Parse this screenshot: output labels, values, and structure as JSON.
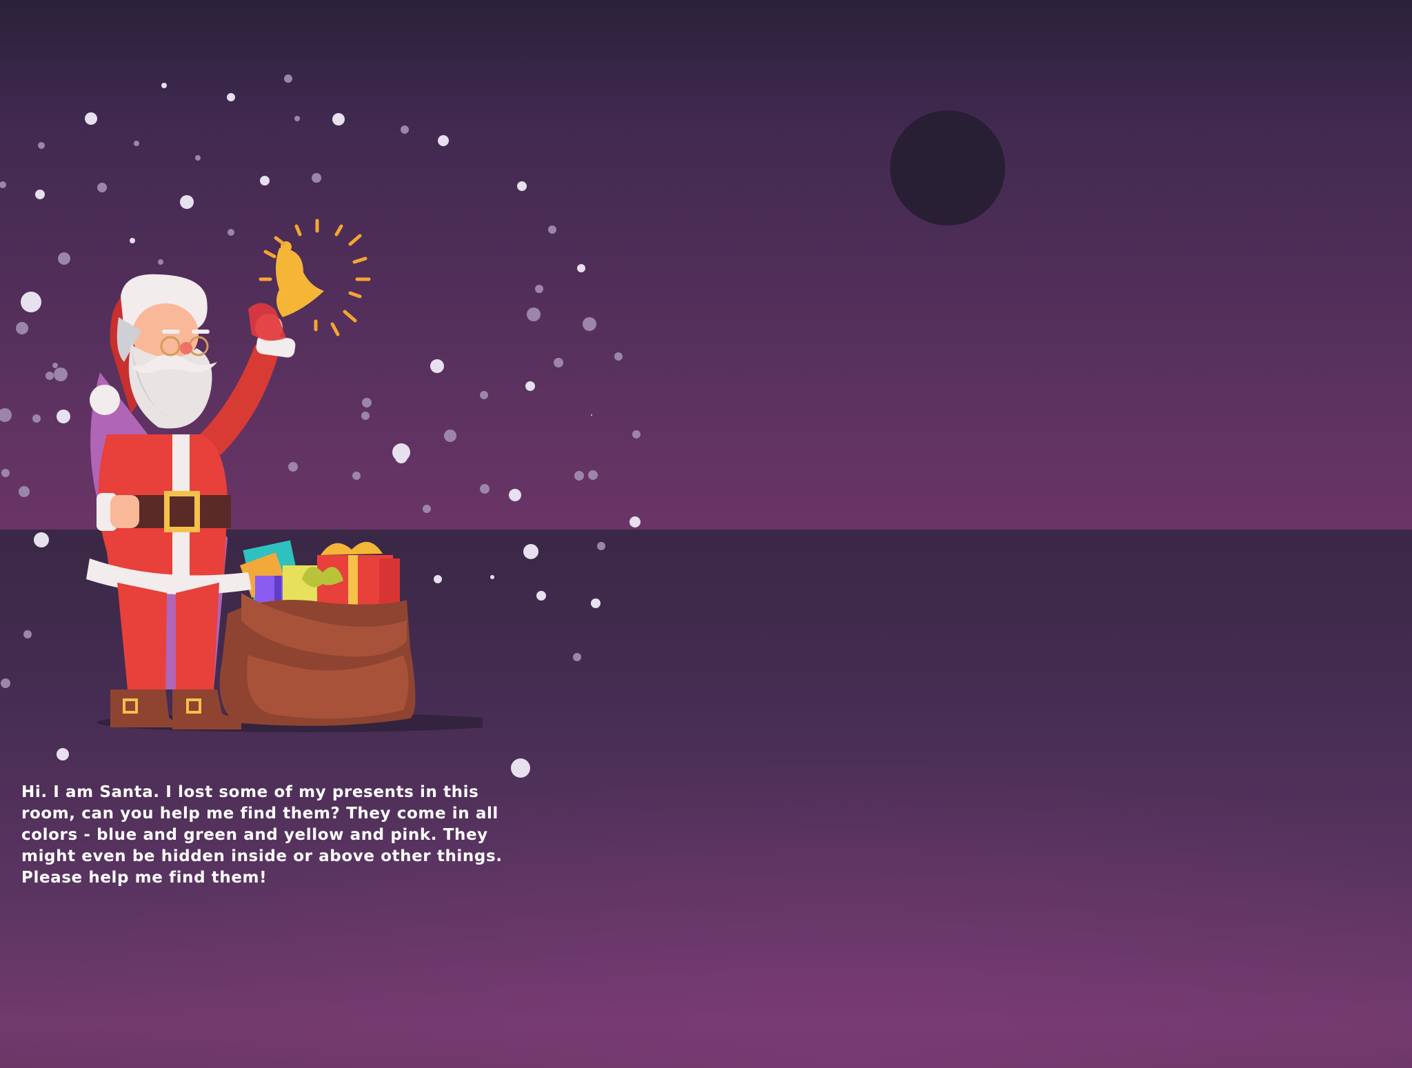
{
  "scene": {
    "name": "santa-room",
    "colors": {
      "wall_top": "#2a2139",
      "wall_bottom": "#6a3566",
      "floor_top": "#3a2845",
      "floor_bottom": "#713a6d",
      "moon": "#281f34",
      "snow": "#e7e0ee",
      "santa_red": "#e8403a",
      "fur_white": "#f2ecec",
      "sack_brown": "#a8523a",
      "bell_gold": "#f5b638"
    },
    "icons": [
      "moon-icon",
      "bell-icon",
      "gift-icon",
      "sack-icon",
      "snowflake-icon"
    ]
  },
  "santa": {
    "message": "Hi. I am Santa. I lost some of my presents in this\nroom, can you help me find them? They come in all\ncolors - blue and green and yellow and pink. They\nmight even be hidden inside  or above other things.\nPlease help me find them!"
  }
}
